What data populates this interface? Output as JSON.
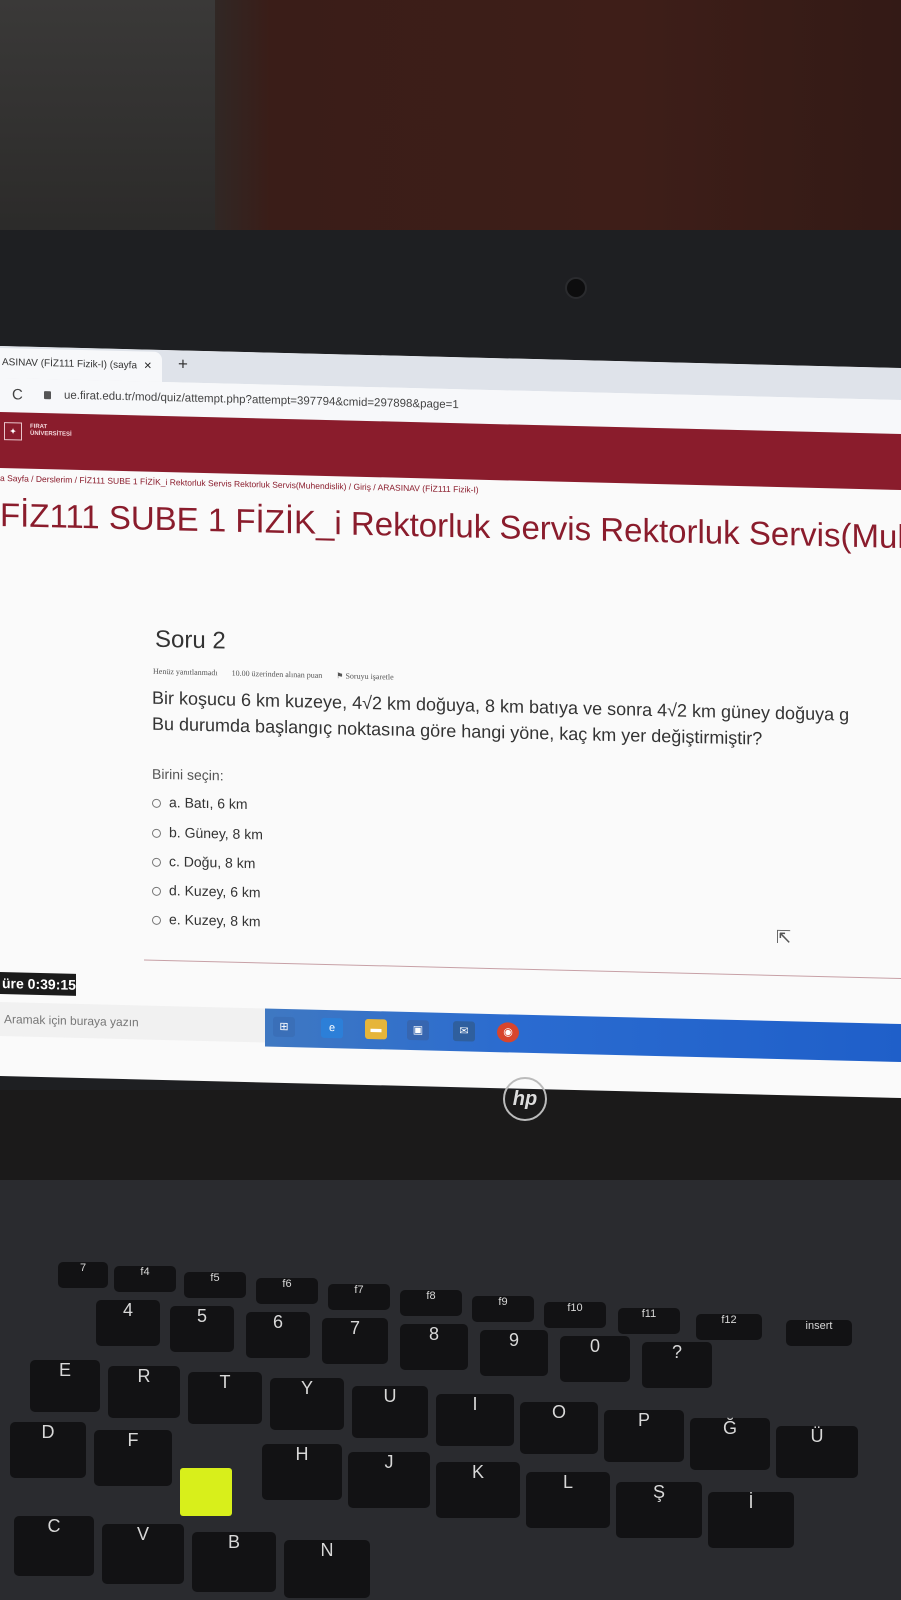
{
  "browser": {
    "tab_title": "ASINAV (FİZ111 Fizik-I) (sayfa",
    "tab_close": "×",
    "new_tab": "+",
    "reload": "C",
    "url": "ue.firat.edu.tr/mod/quiz/attempt.php?attempt=397794&cmid=297898&page=1"
  },
  "banner": {
    "logo_text_1": "FIRAT",
    "logo_text_2": "ÜNİVERSİTESİ"
  },
  "breadcrumb": "a Sayfa / Derslerim / FİZ111 SUBE 1 FİZİK_i Rektorluk Servis Rektorluk Servis(Muhendislik) / Giriş / ARASINAV (FİZ111 Fizik-I)",
  "course_title": "FİZ111 SUBE 1 FİZİK_i Rektorluk Servis Rektorluk Servis(Muh",
  "question": {
    "title": "Soru 2",
    "status": "Henüz yanıtlanmadı",
    "points": "10.00 üzerinden alınan puan",
    "flag": "Soruyu işaretle",
    "text_line1": "Bir koşucu 6 km kuzeye, 4√2 km doğuya, 8 km batıya ve sonra 4√2 km güney doğuya g",
    "text_line2": "Bu durumda başlangıç noktasına göre hangi yöne, kaç km yer değiştirmiştir?",
    "choose_label": "Birini seçin:",
    "options": [
      "a. Batı, 6 km",
      "b. Güney, 8 km",
      "c. Doğu, 8 km",
      "d. Kuzey, 6 km",
      "e. Kuzey, 8 km"
    ]
  },
  "timer": "üre 0:39:15",
  "taskbar": {
    "search_placeholder": "Aramak için buraya yazın"
  },
  "laptop": {
    "brand": "hp"
  },
  "keyboard": {
    "fn_row": [
      "7",
      "f4",
      "f5",
      "f6",
      "f7",
      "f8",
      "f9",
      "f10",
      "f11",
      "f12",
      "insert"
    ],
    "row1": [
      "4",
      "5",
      "6",
      "7",
      "8",
      "9",
      "0",
      "?"
    ],
    "row2": [
      "E",
      "R",
      "T",
      "Y",
      "U",
      "I",
      "O",
      "P",
      "Ğ",
      "Ü"
    ],
    "row3": [
      "D",
      "F",
      "H",
      "J",
      "K",
      "L",
      "Ş",
      "İ"
    ],
    "row4": [
      "C",
      "V",
      "B",
      "N"
    ]
  }
}
